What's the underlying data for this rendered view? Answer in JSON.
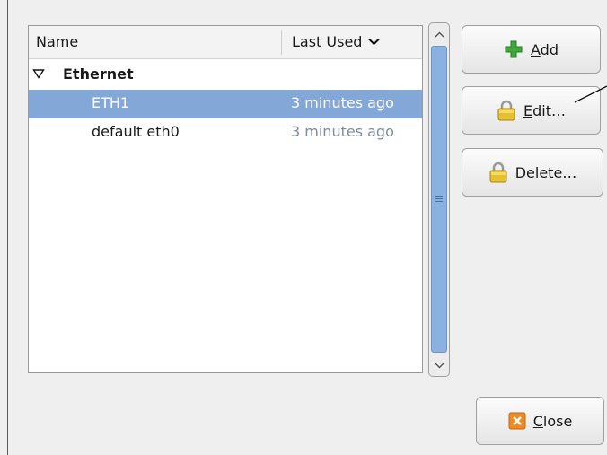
{
  "list": {
    "columns": {
      "name": "Name",
      "last_used": "Last Used"
    },
    "group": {
      "label": "Ethernet",
      "expanded": true
    },
    "connections": [
      {
        "name": "ETH1",
        "last_used": "3 minutes ago",
        "selected": true
      },
      {
        "name": "default eth0",
        "last_used": "3 minutes ago",
        "selected": false
      }
    ]
  },
  "buttons": {
    "add": {
      "mnemonic": "A",
      "rest": "dd"
    },
    "edit": {
      "mnemonic": "E",
      "rest": "dit…"
    },
    "delete": {
      "mnemonic": "D",
      "rest": "elete…"
    },
    "close": {
      "mnemonic": "C",
      "rest": "lose"
    }
  },
  "colors": {
    "selection": "#83a7d6",
    "scroll_thumb": "#8ab1e0",
    "add_icon": "#3fa83c",
    "lock_icon": "#e6c12e",
    "close_icon": "#f08a24"
  },
  "icons": {
    "add": "plus-icon",
    "edit": "lock-icon",
    "delete": "lock-icon",
    "close": "close-icon"
  }
}
